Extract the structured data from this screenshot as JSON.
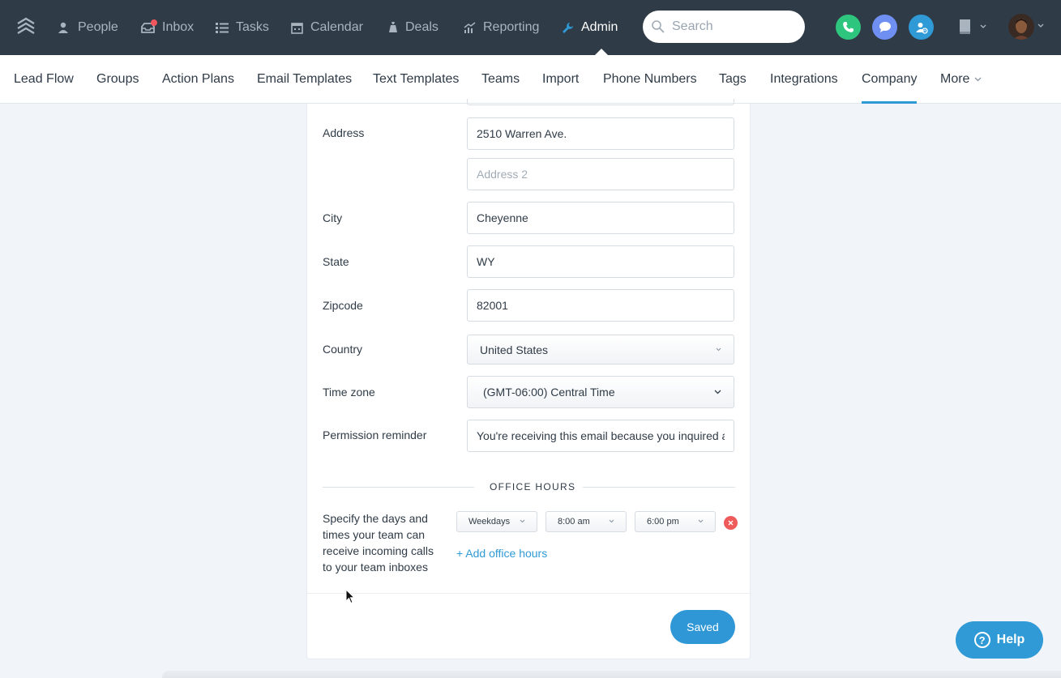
{
  "nav": {
    "items": [
      {
        "label": "People",
        "icon": "person-icon"
      },
      {
        "label": "Inbox",
        "icon": "inbox-icon"
      },
      {
        "label": "Tasks",
        "icon": "list-icon"
      },
      {
        "label": "Calendar",
        "icon": "calendar-icon"
      },
      {
        "label": "Deals",
        "icon": "money-bag-icon"
      },
      {
        "label": "Reporting",
        "icon": "chart-icon"
      },
      {
        "label": "Admin",
        "icon": "wrench-icon",
        "active": true
      }
    ],
    "search_placeholder": "Search",
    "colors": {
      "bar": "#2f3b47",
      "phone": "#2ec67e",
      "chat": "#6f8ff3",
      "contact": "#2f9ad6"
    }
  },
  "subnav": {
    "items": [
      "Lead Flow",
      "Groups",
      "Action Plans",
      "Email Templates",
      "Text Templates",
      "Teams",
      "Import",
      "Phone Numbers",
      "Tags",
      "Integrations",
      "Company",
      "More"
    ],
    "active": "Company"
  },
  "form": {
    "address_label": "Address",
    "address1": "2510 Warren Ave.",
    "address2_placeholder": "Address 2",
    "city_label": "City",
    "city": "Cheyenne",
    "state_label": "State",
    "state": "WY",
    "zipcode_label": "Zipcode",
    "zipcode": "82001",
    "country_label": "Country",
    "country": "United States",
    "timezone_label": "Time zone",
    "timezone": "(GMT-06:00) Central Time",
    "permission_label": "Permission reminder",
    "permission": "You're receiving this email because you inquired a"
  },
  "office_hours": {
    "title": "OFFICE HOURS",
    "description": "Specify the days and times your team can receive incoming calls to your team inboxes",
    "days": "Weekdays",
    "start": "8:00 am",
    "end": "6:00 pm",
    "add_label": "+ Add office hours"
  },
  "footer": {
    "save_label": "Saved"
  },
  "help": {
    "label": "Help"
  }
}
